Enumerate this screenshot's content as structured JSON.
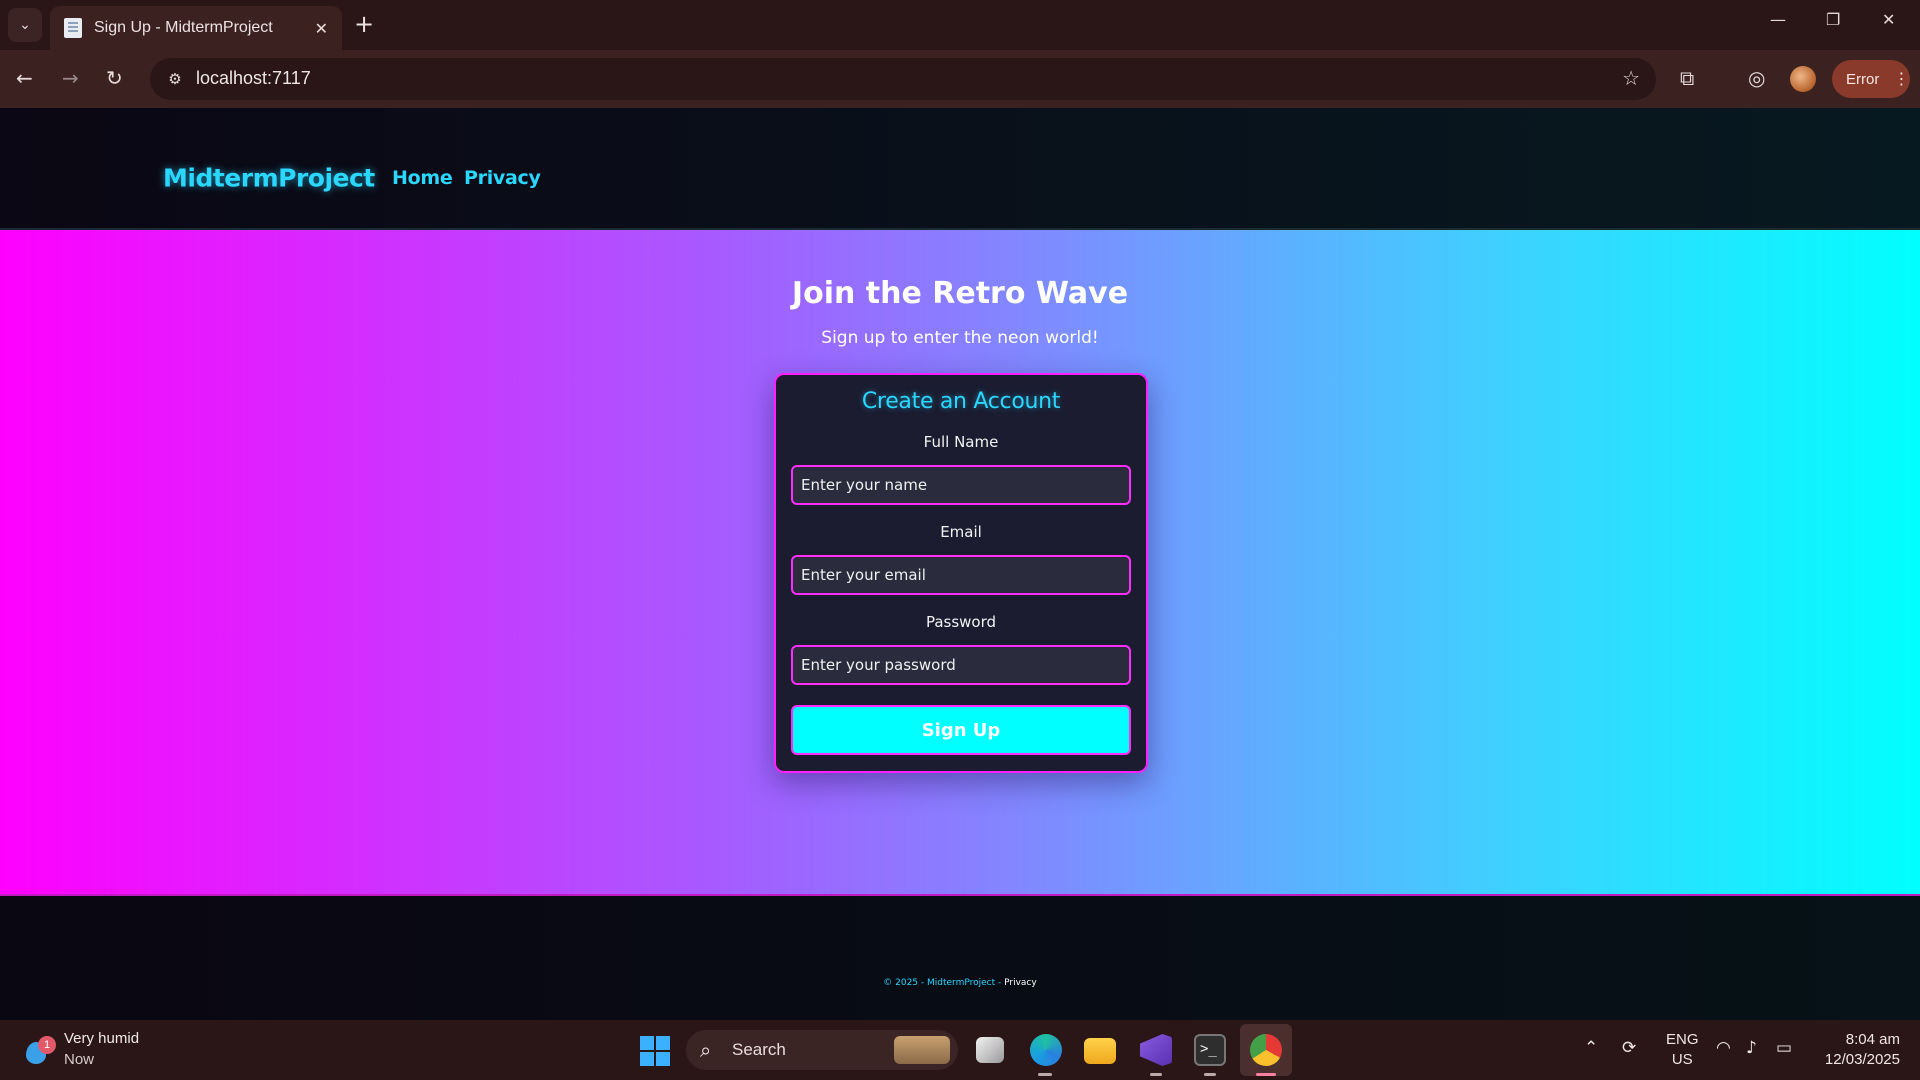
{
  "browser": {
    "tab_title": "Sign Up - MidtermProject",
    "url": "localhost:7117",
    "error_label": "Error"
  },
  "site": {
    "brand": "MidtermProject",
    "nav": {
      "home": "Home",
      "privacy": "Privacy"
    }
  },
  "hero": {
    "title": "Join the Retro Wave",
    "subtitle": "Sign up to enter the neon world!"
  },
  "form": {
    "title": "Create an Account",
    "name_label": "Full Name",
    "name_placeholder": "Enter your name",
    "email_label": "Email",
    "email_placeholder": "Enter your email",
    "password_label": "Password",
    "password_placeholder": "Enter your password",
    "submit_label": "Sign Up"
  },
  "footer": {
    "copyright": "© 2025 - MidtermProject - ",
    "privacy_link": "Privacy"
  },
  "taskbar": {
    "weather_title": "Very humid",
    "weather_sub": "Now",
    "weather_badge": "1",
    "search_label": "Search",
    "lang_line1": "ENG",
    "lang_line2": "US",
    "time": "8:04 am",
    "date": "12/03/2025"
  },
  "colors": {
    "neon_cyan": "#2ad7ff",
    "neon_magenta": "#ff1fff",
    "button_cyan": "#00ffff",
    "card_bg": "#1b1c30"
  },
  "icons": [
    "tab-list-icon",
    "page-favicon",
    "close-icon",
    "plus-icon",
    "minimize-icon",
    "restore-icon",
    "window-close-icon",
    "back-icon",
    "forward-icon",
    "reload-icon",
    "site-info-icon",
    "star-icon",
    "extensions-icon",
    "performance-icon",
    "profile-avatar",
    "menu-dots-icon",
    "windows-start-icon",
    "search-icon",
    "task-view-icon",
    "edge-icon",
    "file-explorer-icon",
    "visual-studio-icon",
    "terminal-icon",
    "chrome-icon",
    "chevron-up-icon",
    "sync-icon",
    "wifi-icon",
    "volume-icon",
    "battery-icon"
  ]
}
